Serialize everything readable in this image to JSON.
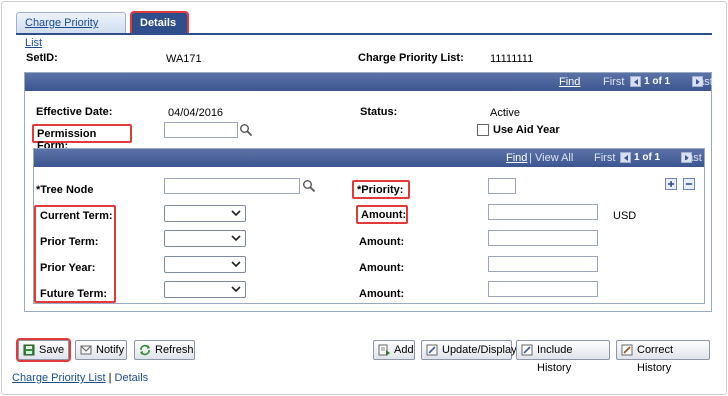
{
  "tabs": {
    "list": "Charge Priority List",
    "details": "Details"
  },
  "header": {
    "setid_label": "SetID:",
    "setid_value": "WA171",
    "cpl_label": "Charge Priority List:",
    "cpl_value": "11111111"
  },
  "outer_nav": {
    "find": "Find",
    "first": "First",
    "count": "1 of 1",
    "last": "Last"
  },
  "main": {
    "effective_date_label": "Effective Date:",
    "effective_date_value": "04/04/2016",
    "status_label": "Status:",
    "status_value": "Active",
    "permission_form_label": "Permission Form:",
    "permission_form_value": "",
    "use_aid_year_label": "Use Aid Year"
  },
  "inner_nav": {
    "find": "Find",
    "sep": "|",
    "view_all": "View All",
    "first": "First",
    "count": "1 of 1",
    "last": "Last"
  },
  "inner": {
    "tree_node_label": "*Tree Node",
    "priority_label": "*Priority:",
    "current_term_label": "Current Term:",
    "prior_term_label": "Prior Term:",
    "prior_year_label": "Prior Year:",
    "future_term_label": "Future Term:",
    "amount_label": "Amount:",
    "currency": "USD"
  },
  "buttons": {
    "save": "Save",
    "notify": "Notify",
    "refresh": "Refresh",
    "add": "Add",
    "update_display": "Update/Display",
    "include_history": "Include History",
    "correct_history": "Correct History"
  },
  "footer": {
    "list_link": "Charge Priority List",
    "sep": "|",
    "details_link": "Details"
  },
  "colors": {
    "accent": "#3c5590",
    "highlight": "#e03a3a",
    "link": "#1a4d8f"
  }
}
